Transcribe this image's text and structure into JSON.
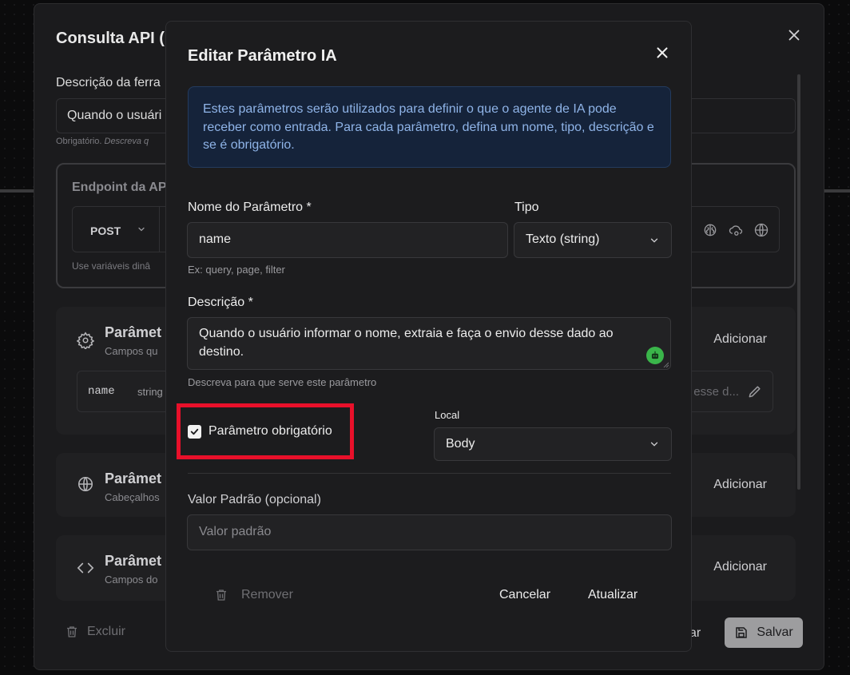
{
  "background_modal": {
    "title": "Consulta API (",
    "description_label": "Descrição da ferra",
    "description_value": "Quando o usuári",
    "description_hint_prefix": "Obrigatório. ",
    "description_hint_em": "Descreva q",
    "endpoint_label": "Endpoint da AP",
    "method": "POST",
    "endpoint_hint": "Use variáveis dinâ",
    "sections": [
      {
        "title": "Parâmet",
        "subtitle": "Campos qu",
        "add_label": "Adicionar",
        "icon": "gear-icon"
      },
      {
        "title": "Parâmet",
        "subtitle": "Cabeçalhos",
        "add_label": "Adicionar",
        "icon": "globe-icon"
      },
      {
        "title": "Parâmet",
        "subtitle": "Campos do",
        "add_label": "Adicionar",
        "icon": "code-icon"
      }
    ],
    "param_row": {
      "name": "name",
      "type": "string",
      "description": "esse d..."
    },
    "delete_label": "Excluir",
    "cancel_partial": "ar",
    "save_label": "Salvar"
  },
  "modal": {
    "title": "Editar Parâmetro IA",
    "info_text": "Estes parâmetros serão utilizados para definir o que o agente de IA pode receber como entrada. Para cada parâmetro, defina um nome, tipo, descrição e se é obrigatório.",
    "name_label": "Nome do Parâmetro *",
    "name_value": "name",
    "name_hint": "Ex: query, page, filter",
    "type_label": "Tipo",
    "type_value": "Texto (string)",
    "description_label": "Descrição *",
    "description_value": "Quando o usuário informar o nome, extraia e faça o envio desse dado ao destino.",
    "description_hint": "Descreva para que serve este parâmetro",
    "required_label": "Parâmetro obrigatório",
    "required_checked": true,
    "location_label": "Local",
    "location_value": "Body",
    "default_label": "Valor Padrão (opcional)",
    "default_placeholder": "Valor padrão",
    "remove_label": "Remover",
    "cancel_label": "Cancelar",
    "update_label": "Atualizar"
  },
  "colors": {
    "highlight": "#e8102a",
    "info_bg": "#15233a",
    "info_text": "#8fb4e8",
    "bot_green": "#3ab54a"
  }
}
